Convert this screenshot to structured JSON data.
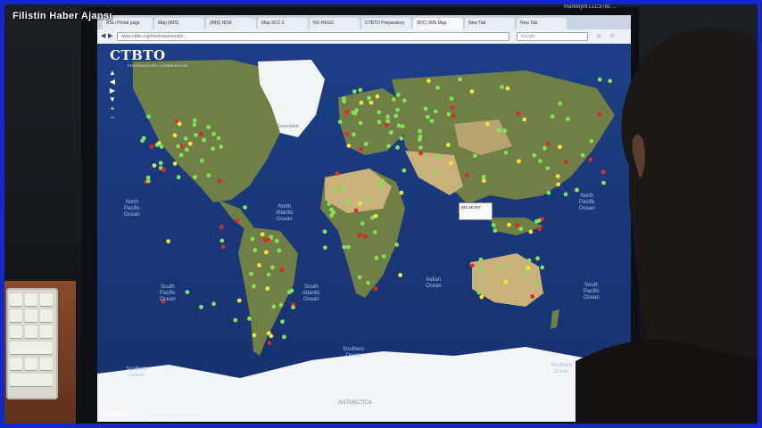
{
  "watermark": "Filistin Haber Ajansı",
  "stray_text": "Marktoynt LLC3781 ...",
  "browser": {
    "tabs": [
      "RSLi Portal page",
      "Map (IMS)",
      "(IMS) NOA",
      "Map 3CC 3",
      "NC-REGC",
      "CTBTO Preparatory",
      "(IDC) IMS Map",
      "New Tab",
      "New Tab"
    ],
    "active_tab": 6,
    "url": "www.ctbto.org/ims/map/events/ ...",
    "search_placeholder": "Google"
  },
  "map": {
    "logo": "CTBTO",
    "logo_subtitle": "PREPARATORY COMMISSION",
    "zoom_controls": [
      "▲",
      "◀ ▶",
      "▼",
      "+",
      "–"
    ],
    "popup_text": "BELMONT",
    "brand": "Google",
    "attribution": "Map data ©2012 - Terms of Use",
    "labels": {
      "north_pacific": "North\nPacific\nOcean",
      "north_atlantic": "North\nAtlantic\nOcean",
      "south_pacific": "South\nPacific\nOcean",
      "south_atlantic": "South\nAtlantic\nOcean",
      "indian_ocean": "Indian\nOcean",
      "south_pacific_right": "South\nPacific\nOcean",
      "north_pacific_right": "North\nPacific\nOcean",
      "southern_ocean_left": "Southern\nOcean",
      "southern_ocean_mid": "Southern\nOcean",
      "southern_ocean_right": "Southern\nOcean",
      "antarctica": "ANTARCTICA",
      "greenland": "Greenland"
    },
    "colors": {
      "ocean": "#1d3f86",
      "ocean_deep": "#16306c",
      "land": "#6f7f46",
      "desert": "#c8b27a",
      "ice": "#f3f5f7",
      "station_green": "#7fe35a",
      "station_yellow": "#f2e23c",
      "station_red": "#e02a22"
    }
  }
}
